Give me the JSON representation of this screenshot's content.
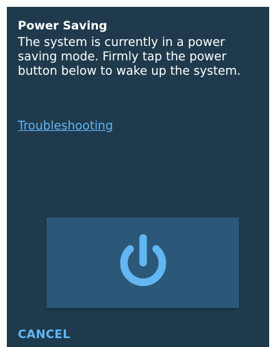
{
  "dialog": {
    "title": "Power Saving",
    "message": "The system is currently in a power saving mode. Firmly tap the power button below to wake up the system.",
    "troubleshooting_link": "Troubleshooting",
    "power_button_icon": "power-icon",
    "cancel_label": "CANCEL"
  },
  "colors": {
    "background": "#1f3a4d",
    "button": "#2b5878",
    "accent": "#62b6f2",
    "text": "#ffffff"
  }
}
